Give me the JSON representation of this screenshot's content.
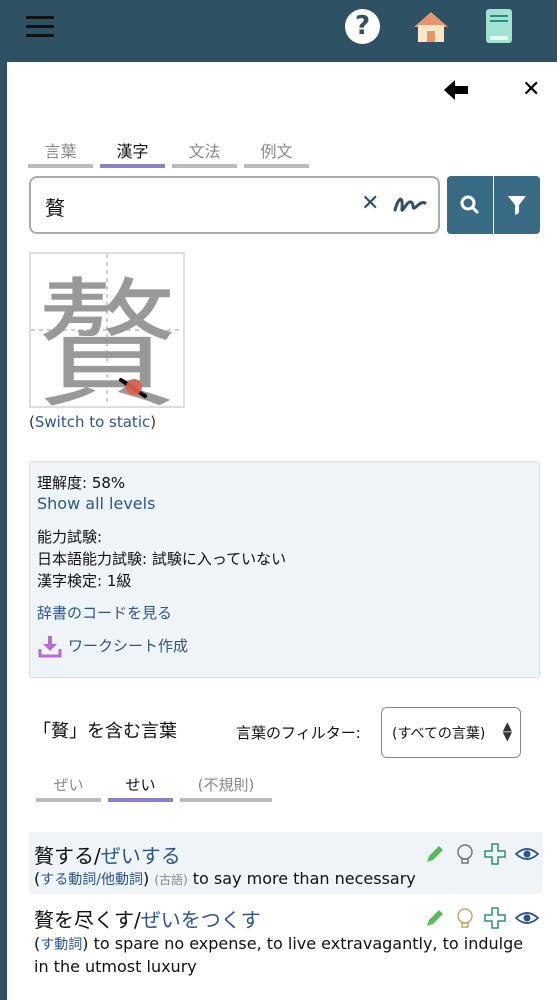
{
  "header": {
    "icons": [
      "menu-icon",
      "help-icon",
      "home-icon",
      "book-icon"
    ]
  },
  "tabs": [
    "言葉",
    "漢字",
    "文法",
    "例文"
  ],
  "search": {
    "value": "贅"
  },
  "stroke_diagram": {
    "character": "贅"
  },
  "switch_link": {
    "open": "(",
    "label": "Switch to static",
    "close": ")"
  },
  "info": {
    "understanding": "理解度: 58%",
    "show_levels": "Show all levels",
    "exam_heading": "能力試験:",
    "jlpt": "日本語能力試験: 試験に入っていない",
    "kanken": "漢字検定: 1級",
    "dict_codes": "辞書のコードを見る",
    "worksheet": "ワークシート作成"
  },
  "words_section": {
    "title": "「贅」を含む言葉",
    "filter_label": "言葉のフィルター:",
    "filter_value": "(すべての言葉)"
  },
  "reading_tabs": [
    "ぜい",
    "せい",
    "(不規則)"
  ],
  "entries": [
    {
      "word": "贅する",
      "reading": "ぜいする",
      "pos_open": "(",
      "pos": "する動詞/他動詞",
      "pos_close": ")",
      "tag": "(古語)",
      "meaning": "to say more than necessary"
    },
    {
      "word": "贅を尽くす",
      "reading": "ぜいをつくす",
      "pos_open": "(",
      "pos": "す動詞",
      "pos_close": ")",
      "meaning": "to spare no expense, to live extravagantly, to indulge in the utmost luxury"
    }
  ],
  "colors": {
    "header": "#2e5163",
    "accent": "#8d7fc7",
    "link": "#2c5590",
    "info_bg": "#eef4f8"
  }
}
